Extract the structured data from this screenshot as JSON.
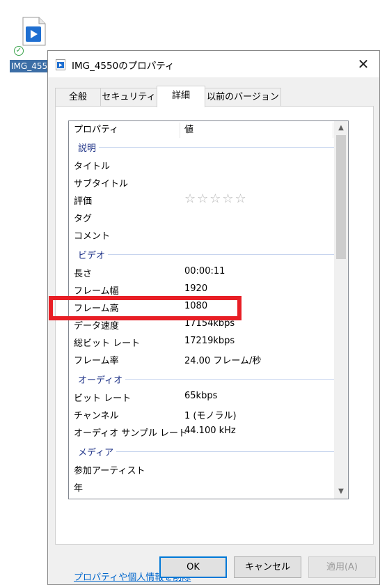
{
  "desktop": {
    "file_label": "IMG_455"
  },
  "dialog": {
    "title": "IMG_4550のプロパティ",
    "close_glyph": "✕",
    "tabs": [
      {
        "label": "全般"
      },
      {
        "label": "セキュリティ"
      },
      {
        "label": "詳細",
        "active": true
      },
      {
        "label": "以前のバージョン"
      }
    ],
    "list": {
      "col_property": "プロパティ",
      "col_value": "値",
      "groups": {
        "description": "説明",
        "video": "ビデオ",
        "audio": "オーディオ",
        "media": "メディア"
      },
      "rows": {
        "title": {
          "key": "タイトル",
          "value": ""
        },
        "subtitle": {
          "key": "サブタイトル",
          "value": ""
        },
        "rating": {
          "key": "評価",
          "value": "☆☆☆☆☆"
        },
        "tags": {
          "key": "タグ",
          "value": ""
        },
        "comments": {
          "key": "コメント",
          "value": ""
        },
        "length": {
          "key": "長さ",
          "value": "00:00:11"
        },
        "frame_width": {
          "key": "フレーム幅",
          "value": "1920"
        },
        "frame_height": {
          "key": "フレーム高",
          "value": "1080"
        },
        "data_rate": {
          "key": "データ速度",
          "value": "17154kbps"
        },
        "total_bitrate": {
          "key": "総ビット レート",
          "value": "17219kbps"
        },
        "frame_rate": {
          "key": "フレーム率",
          "value": "24.00 フレーム/秒"
        },
        "bitrate": {
          "key": "ビット レート",
          "value": "65kbps"
        },
        "channels": {
          "key": "チャンネル",
          "value": "1 (モノラル)"
        },
        "sample_rate": {
          "key": "オーディオ サンプル レート",
          "value": "44.100 kHz"
        },
        "contributing_artists": {
          "key": "参加アーティスト",
          "value": ""
        },
        "year": {
          "key": "年",
          "value": ""
        }
      }
    },
    "remove_link": "プロパティや個人情報を削除",
    "buttons": {
      "ok": "OK",
      "cancel": "キャンセル",
      "apply": "適用(A)"
    }
  },
  "colors": {
    "highlight": "#e81e25",
    "accent": "#0078d7",
    "group_text": "#1e3287",
    "link": "#0066cc"
  }
}
